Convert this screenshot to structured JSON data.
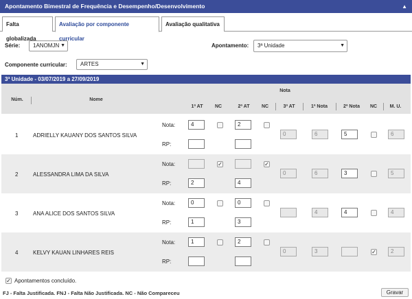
{
  "window": {
    "title": "Apontamento Bimestral de Frequência e Desempenho/Desenvolvimento"
  },
  "tabs": [
    {
      "label": "Falta globalizada"
    },
    {
      "label": "Avaliação por componente curricular"
    },
    {
      "label": "Avaliação qualitativa"
    }
  ],
  "filters": {
    "serie_label": "Série:",
    "serie_value": "1ANOMJN",
    "apontamento_label": "Apontamento:",
    "apontamento_value": "3ª Unidade",
    "componente_label": "Componente curricular:",
    "componente_value": "ARTES"
  },
  "section": {
    "title": "3ª Unidade - 03/07/2019 a 27/09/2019"
  },
  "table": {
    "group_header": "Nota",
    "headers": {
      "num": "Núm.",
      "nome": "Nome",
      "at1": "1ª AT",
      "nc1": "NC",
      "at2": "2ª AT",
      "nc2": "NC",
      "at3": "3ª AT",
      "nota1": "1ª Nota",
      "nota2": "2ª Nota",
      "nc3": "NC",
      "mu": "M. U."
    },
    "nota_label": "Nota:",
    "rp_label": "RP:",
    "rows": [
      {
        "num": "1",
        "name": "ADRIELLY KAUANY DOS SANTOS SILVA",
        "at1_nota": "4",
        "at1_rp": "",
        "nc1": false,
        "at2_nota": "2",
        "at2_rp": "",
        "nc2": false,
        "at3": "0",
        "nota1": "6",
        "nota2": "5",
        "nc3": false,
        "mu": "6"
      },
      {
        "num": "2",
        "name": "ALESSANDRA LIMA DA SILVA",
        "at1_nota": "",
        "at1_rp": "2",
        "nc1": true,
        "at2_nota": "",
        "at2_rp": "4",
        "nc2": true,
        "at3": "0",
        "nota1": "6",
        "nota2": "3",
        "nc3": false,
        "mu": "5"
      },
      {
        "num": "3",
        "name": "ANA ALICE DOS SANTOS SILVA",
        "at1_nota": "0",
        "at1_rp": "1",
        "nc1": false,
        "at2_nota": "0",
        "at2_rp": "3",
        "nc2": false,
        "at3": "",
        "nota1": "4",
        "nota2": "4",
        "nc3": false,
        "mu": "4"
      },
      {
        "num": "4",
        "name": "KELVY KAUAN LINHARES REIS",
        "at1_nota": "1",
        "at1_rp": "",
        "nc1": false,
        "at2_nota": "2",
        "at2_rp": "",
        "nc2": false,
        "at3": "0",
        "nota1": "3",
        "nota2": "",
        "nc3": true,
        "mu": "2"
      }
    ]
  },
  "footer": {
    "concluded_label": "Apontamentos concluído.",
    "concluded_checked": true,
    "legend": "FJ - Falta Justificada. FNJ - Falta Não Justificada. NC - Não Compareceu",
    "save_label": "Gravar"
  },
  "colors": {
    "header_bar": "#3b4d99",
    "active_tab_text": "#2d4a9a"
  }
}
